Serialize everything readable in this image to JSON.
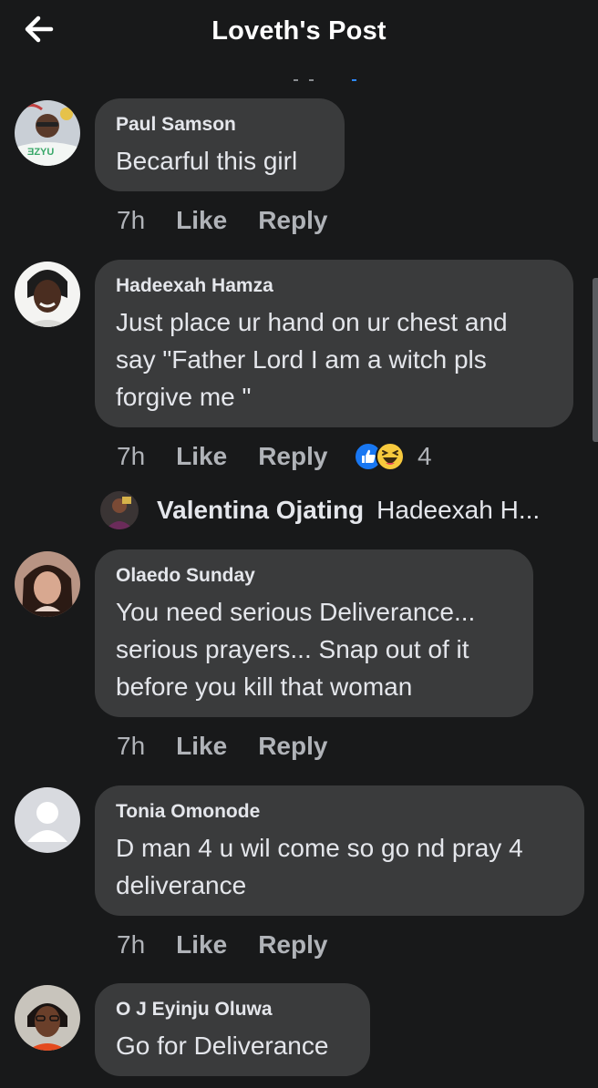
{
  "header": {
    "title": "Loveth's Post",
    "back_icon": "arrow-left-icon"
  },
  "colors": {
    "background": "#18191a",
    "bubble": "#3a3b3c",
    "primary_text": "#e4e6eb",
    "secondary_text": "#b0b3b8",
    "like_blue": "#1877f2"
  },
  "comments": [
    {
      "author": "Paul Samson",
      "text": "Becarful this girl",
      "time": "7h",
      "like_label": "Like",
      "reply_label": "Reply"
    },
    {
      "author": "Hadeexah Hamza",
      "text": "Just place ur hand on ur chest and say \"Father Lord I am a witch pls forgive me \"",
      "time": "7h",
      "like_label": "Like",
      "reply_label": "Reply",
      "reaction_count": "4",
      "reactions": [
        "like-reaction-icon",
        "haha-reaction-icon"
      ],
      "reply_preview": {
        "author": "Valentina Ojating",
        "snippet": "Hadeexah H..."
      }
    },
    {
      "author": "Olaedo Sunday",
      "text": "You need serious Deliverance... serious prayers... Snap out of it before you kill that woman",
      "time": "7h",
      "like_label": "Like",
      "reply_label": "Reply"
    },
    {
      "author": "Tonia Omonode",
      "text": "D man 4 u wil come so go nd pray 4 deliverance",
      "time": "7h",
      "like_label": "Like",
      "reply_label": "Reply"
    },
    {
      "author": "O J Eyinju Oluwa",
      "text": "Go for Deliverance"
    }
  ]
}
